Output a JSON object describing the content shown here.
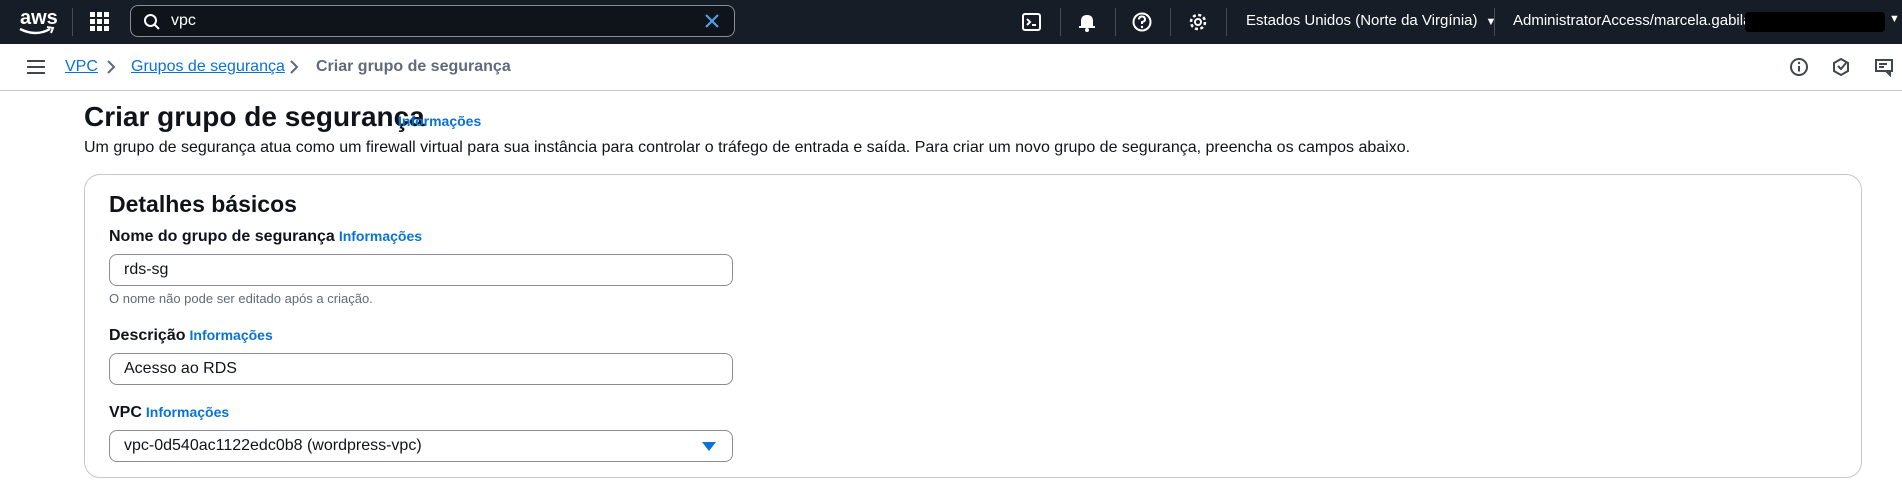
{
  "topnav": {
    "logo_text": "aws",
    "search_value": "vpc",
    "region": "Estados Unidos (Norte da Virgínia)",
    "account": "AdministratorAccess/marcela.gabilan."
  },
  "breadcrumb": {
    "items": [
      {
        "label": "VPC"
      },
      {
        "label": "Grupos de segurança"
      },
      {
        "label": "Criar grupo de segurança"
      }
    ]
  },
  "header": {
    "title": "Criar grupo de segurança",
    "info": "Informações",
    "description": "Um grupo de segurança atua como um firewall virtual para sua instância para controlar o tráfego de entrada e saída. Para criar um novo grupo de segurança, preencha os campos abaixo."
  },
  "basic_details": {
    "title": "Detalhes básicos",
    "name_field": {
      "label": "Nome do grupo de segurança",
      "info": "Informações",
      "value": "rds-sg",
      "hint": "O nome não pode ser editado após a criação."
    },
    "description_field": {
      "label": "Descrição",
      "info": "Informações",
      "value": "Acesso ao RDS"
    },
    "vpc_field": {
      "label": "VPC",
      "info": "Informações",
      "value": "vpc-0d540ac1122edc0b8 (wordpress-vpc)"
    }
  },
  "colors": {
    "nav_bg": "#161d26",
    "link": "#0972d3",
    "text": "#0f141a",
    "muted": "#5f6b7a",
    "border": "#8c8c94"
  },
  "icons": [
    "grid-icon",
    "search-icon",
    "clear-icon",
    "cloudshell-icon",
    "bell-icon",
    "help-icon",
    "gear-icon",
    "hamburger-icon",
    "info-icon",
    "notifications-icon",
    "feedback-icon",
    "chevron-right-icon",
    "caret-down-icon"
  ]
}
